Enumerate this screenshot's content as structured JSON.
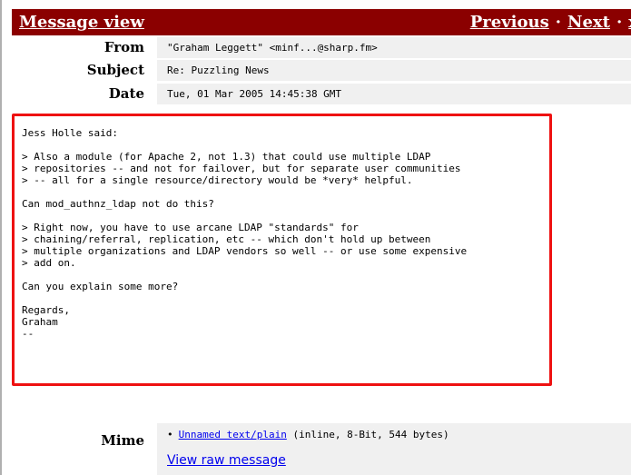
{
  "titlebar": {
    "title": "Message view",
    "previous_label": "Previous",
    "next_label": "Next",
    "separator": "·",
    "close_label": "x"
  },
  "headers": [
    {
      "label": "From",
      "value": "\"Graham Leggett\" <minf...@sharp.fm>"
    },
    {
      "label": "Subject",
      "value": "Re: Puzzling News"
    },
    {
      "label": "Date",
      "value": "Tue, 01 Mar 2005 14:45:38 GMT"
    }
  ],
  "body": "Jess Holle said:\n\n> Also a module (for Apache 2, not 1.3) that could use multiple LDAP\n> repositories -- and not for failover, but for separate user communities\n> -- all for a single resource/directory would be *very* helpful.\n\nCan mod_authnz_ldap not do this?\n\n> Right now, you have to use arcane LDAP \"standards\" for\n> chaining/referral, replication, etc -- which don't hold up between\n> multiple organizations and LDAP vendors so well -- or use some expensive\n> add on.\n\nCan you explain some more?\n\nRegards,\nGraham\n--",
  "mime": {
    "label": "Mime",
    "bullet": "•",
    "attachment_link": "Unnamed text/plain",
    "attachment_info": " (inline, 8-Bit, 544 bytes)",
    "raw_link": "View raw message"
  },
  "colors": {
    "titlebar_bg": "#8b0000",
    "highlight_border": "#ee1111",
    "row_bg": "#f0f0f0",
    "link": "#0000ee"
  }
}
